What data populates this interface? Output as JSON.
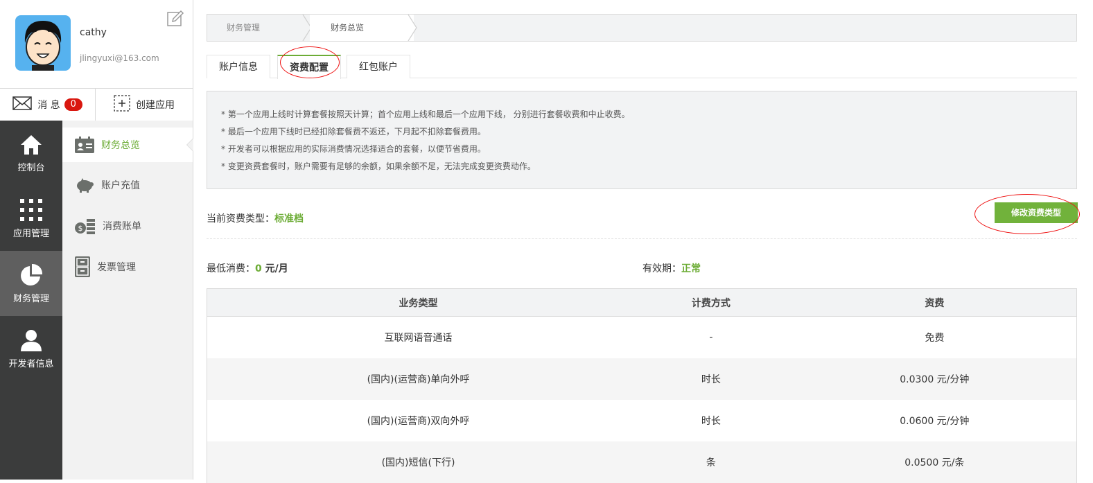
{
  "user": {
    "name": "cathy",
    "email": "jlingyuxi@163.com"
  },
  "quickbar": {
    "messages_label": "消 息",
    "messages_count": "0",
    "create_app_label": "创建应用"
  },
  "mainnav": [
    {
      "label": "控制台",
      "icon": "home-icon"
    },
    {
      "label": "应用管理",
      "icon": "grid-icon"
    },
    {
      "label": "财务管理",
      "icon": "pie-chart-icon"
    },
    {
      "label": "开发者信息",
      "icon": "user-icon"
    }
  ],
  "subnav": [
    {
      "label": "财务总览",
      "icon": "id-card-icon"
    },
    {
      "label": "账户充值",
      "icon": "piggy-bank-icon"
    },
    {
      "label": "消费账单",
      "icon": "coins-icon"
    },
    {
      "label": "发票管理",
      "icon": "file-cabinet-icon"
    }
  ],
  "breadcrumb": [
    "财务管理",
    "财务总览"
  ],
  "tabs": [
    "账户信息",
    "资费配置",
    "红包账户"
  ],
  "notice": [
    "* 第一个应用上线时计算套餐按照天计算；首个应用上线和最后一个应用下线， 分别进行套餐收费和中止收费。",
    "* 最后一个应用下线时已经扣除套餐费不返还，下月起不扣除套餐费用。",
    "* 开发者可以根据应用的实际消费情况选择适合的套餐，以便节省费用。",
    "* 变更资费套餐时，账户需要有足够的余额，如果余额不足，无法完成变更资费动作。"
  ],
  "current_type": {
    "label": "当前资费类型：",
    "value": "标准档"
  },
  "modify_button": "修改资费类型",
  "min_fee": {
    "label": "最低消费：",
    "value": "0",
    "unit": " 元/月"
  },
  "validity": {
    "label": "有效期：",
    "value": "正常"
  },
  "table": {
    "headers": [
      "业务类型",
      "计费方式",
      "资费"
    ],
    "rows": [
      [
        "互联网语音通话",
        "-",
        "免费"
      ],
      [
        "(国内)(运营商)单向外呼",
        "时长",
        "0.0300 元/分钟"
      ],
      [
        "(国内)(运营商)双向外呼",
        "时长",
        "0.0600 元/分钟"
      ],
      [
        "(国内)短信(下行)",
        "条",
        "0.0500 元/条"
      ]
    ]
  },
  "colors": {
    "accent": "#6cac35",
    "nav_dark": "#3b3c3c",
    "nav_active": "#5f5f5f",
    "badge": "#d9170f",
    "annotation": "#e11111"
  }
}
